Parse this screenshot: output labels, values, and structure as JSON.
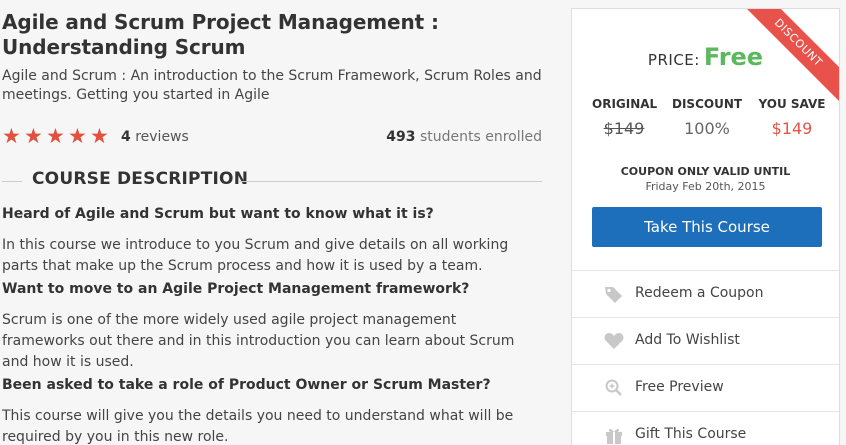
{
  "course": {
    "title": "Agile and Scrum Project Management : Understanding Scrum",
    "subtitle": "Agile and Scrum : An introduction to the Scrum Framework, Scrum Roles and meetings. Getting you started in Agile",
    "rating": 5,
    "reviews_count": "4",
    "reviews_label": "reviews",
    "students_count": "493",
    "students_label": "students enrolled"
  },
  "description": {
    "heading": "COURSE DESCRIPTION",
    "blocks": [
      {
        "q": "Heard of Agile and Scrum but want to know what it is?",
        "a": "In this course we introduce to you Scrum and give details on all working parts that make up the Scrum process and how it is used by a team."
      },
      {
        "q": "Want to move to an Agile Project Management framework?",
        "a": "Scrum is one of the more widely used agile project management frameworks out there and in this introduction you can learn about Scrum and how it is used."
      },
      {
        "q": "Been asked to take a role of Product Owner or Scrum Master?",
        "a": "This course will give you the details you need to understand what will be required by you in this new role."
      }
    ]
  },
  "panel": {
    "ribbon": "DISCOUNT",
    "price_label": "PRICE:",
    "price_value": "Free",
    "original_label": "ORIGINAL",
    "original_value": "$149",
    "discount_label": "DISCOUNT",
    "discount_value": "100%",
    "save_label": "YOU SAVE",
    "save_value": "$149",
    "coupon_heading": "COUPON ONLY VALID UNTIL",
    "coupon_date": "Friday Feb 20th, 2015",
    "take_button": "Take This Course",
    "actions": [
      {
        "label": "Redeem a Coupon",
        "icon": "tag-icon"
      },
      {
        "label": "Add To Wishlist",
        "icon": "heart-icon"
      },
      {
        "label": "Free Preview",
        "icon": "magnifier-icon"
      },
      {
        "label": "Gift This Course",
        "icon": "gift-icon"
      }
    ]
  },
  "colors": {
    "accent_blue": "#1e6fbb",
    "star_red": "#e0523f",
    "free_green": "#5cb85c",
    "save_red": "#e8524a"
  }
}
